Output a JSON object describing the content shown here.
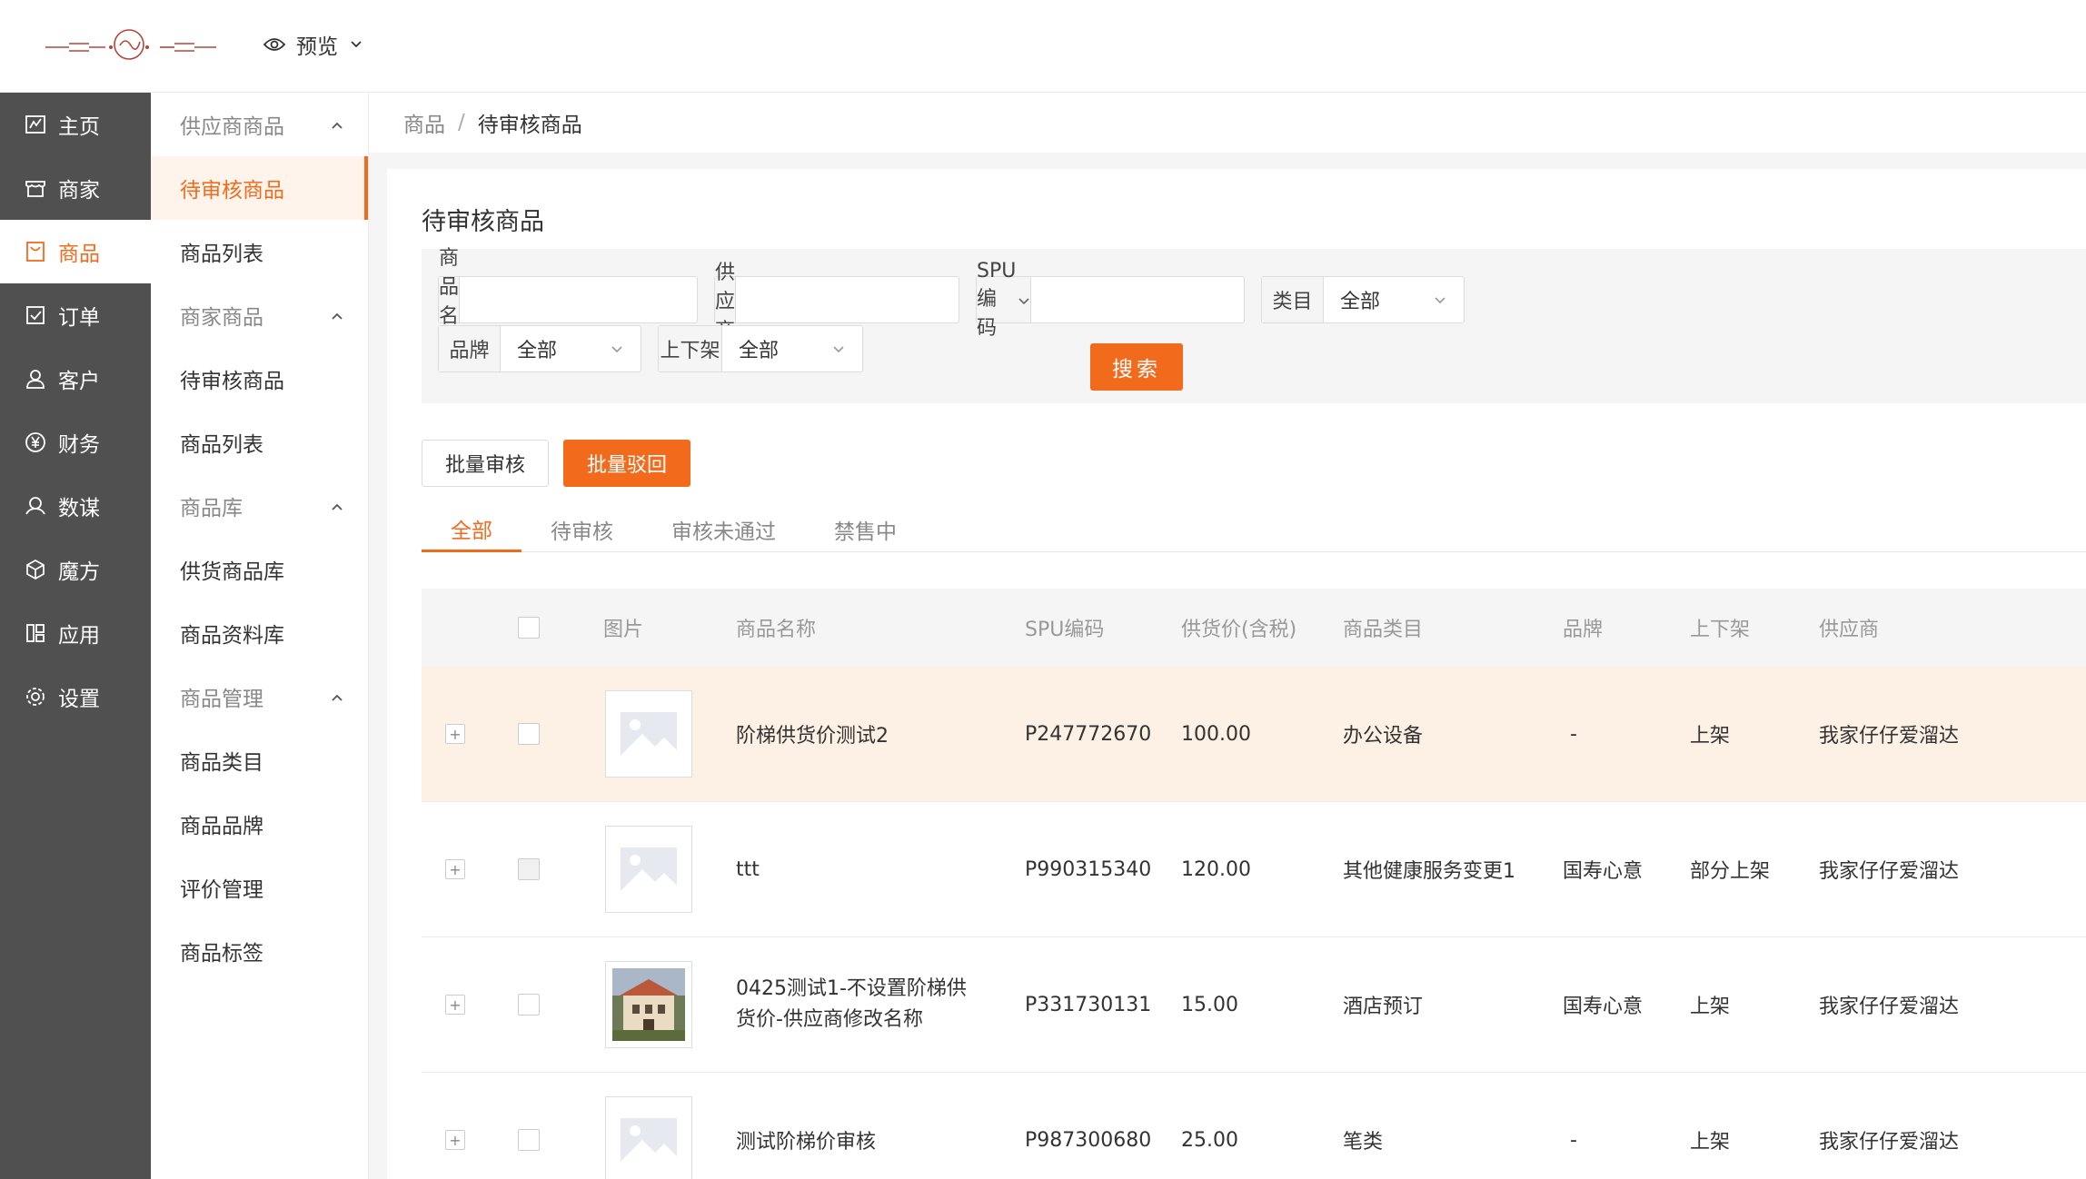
{
  "header": {
    "preview_label": "预览"
  },
  "sidebar": {
    "items": [
      {
        "label": "主页",
        "icon": "dashboard-icon",
        "active": false
      },
      {
        "label": "商家",
        "icon": "store-icon",
        "active": false
      },
      {
        "label": "商品",
        "icon": "goods-icon",
        "active": true
      },
      {
        "label": "订单",
        "icon": "order-icon",
        "active": false
      },
      {
        "label": "客户",
        "icon": "user-icon",
        "active": false
      },
      {
        "label": "财务",
        "icon": "yen-icon",
        "active": false
      },
      {
        "label": "数谋",
        "icon": "data-icon",
        "active": false
      },
      {
        "label": "魔方",
        "icon": "cube-icon",
        "active": false
      },
      {
        "label": "应用",
        "icon": "apps-icon",
        "active": false
      },
      {
        "label": "设置",
        "icon": "gear-icon",
        "active": false
      }
    ]
  },
  "subsidebar": {
    "groups": [
      {
        "label": "供应商商品",
        "items": [
          "待审核商品",
          "商品列表"
        ]
      },
      {
        "label": "商家商品",
        "items": [
          "待审核商品",
          "商品列表"
        ]
      },
      {
        "label": "商品库",
        "items": [
          "供货商品库",
          "商品资料库"
        ]
      },
      {
        "label": "商品管理",
        "items": [
          "商品类目",
          "商品品牌",
          "评价管理",
          "商品标签"
        ]
      }
    ]
  },
  "breadcrumb": {
    "parent": "商品",
    "sep": "/",
    "current": "待审核商品"
  },
  "page": {
    "title": "待审核商品"
  },
  "filters": {
    "product_name_label": "商品名称",
    "product_name_value": "",
    "supplier_label": "供应商",
    "supplier_value": "",
    "spu_label": "SPU编码",
    "spu_value": "",
    "category_label": "类目",
    "category_value": "全部",
    "brand_label": "品牌",
    "brand_value": "全部",
    "shelf_label": "上下架",
    "shelf_value": "全部",
    "search_button": "搜索"
  },
  "actions": {
    "batch_approve": "批量审核",
    "batch_reject": "批量驳回"
  },
  "tabs": [
    {
      "label": "全部",
      "active": true
    },
    {
      "label": "待审核",
      "active": false
    },
    {
      "label": "审核未通过",
      "active": false
    },
    {
      "label": "禁售中",
      "active": false
    }
  ],
  "table": {
    "columns": [
      "图片",
      "商品名称",
      "SPU编码",
      "供货价(含税)",
      "商品类目",
      "品牌",
      "上下架",
      "供应商"
    ],
    "rows": [
      {
        "name": "阶梯供货价测试2",
        "name2": "",
        "spu": "P247772670",
        "price": "100.00",
        "category": "办公设备",
        "brand": "-",
        "shelf": "上架",
        "supplier": "我家仔仔爱溜达",
        "image": "placeholder",
        "highlight": true,
        "checkbox_disabled": false
      },
      {
        "name": "ttt",
        "name2": "",
        "spu": "P990315340",
        "price": "120.00",
        "category": "其他健康服务变更1",
        "brand": "国寿心意",
        "shelf": "部分上架",
        "supplier": "我家仔仔爱溜达",
        "image": "placeholder",
        "highlight": false,
        "checkbox_disabled": true
      },
      {
        "name": "0425测试1-不设置阶梯供",
        "name2": "货价-供应商修改名称",
        "spu": "P331730131",
        "price": "15.00",
        "category": "酒店预订",
        "brand": "国寿心意",
        "shelf": "上架",
        "supplier": "我家仔仔爱溜达",
        "image": "house-photo",
        "highlight": false,
        "checkbox_disabled": false
      },
      {
        "name": "测试阶梯价审核",
        "name2": "",
        "spu": "P987300680",
        "price": "25.00",
        "category": "笔类",
        "brand": "-",
        "shelf": "上架",
        "supplier": "我家仔仔爱溜达",
        "image": "placeholder",
        "highlight": false,
        "checkbox_disabled": false
      }
    ]
  },
  "colors": {
    "accent": "#f26b1d",
    "sidebar_bg": "#505050",
    "row_highlight": "#fdf0e4"
  }
}
